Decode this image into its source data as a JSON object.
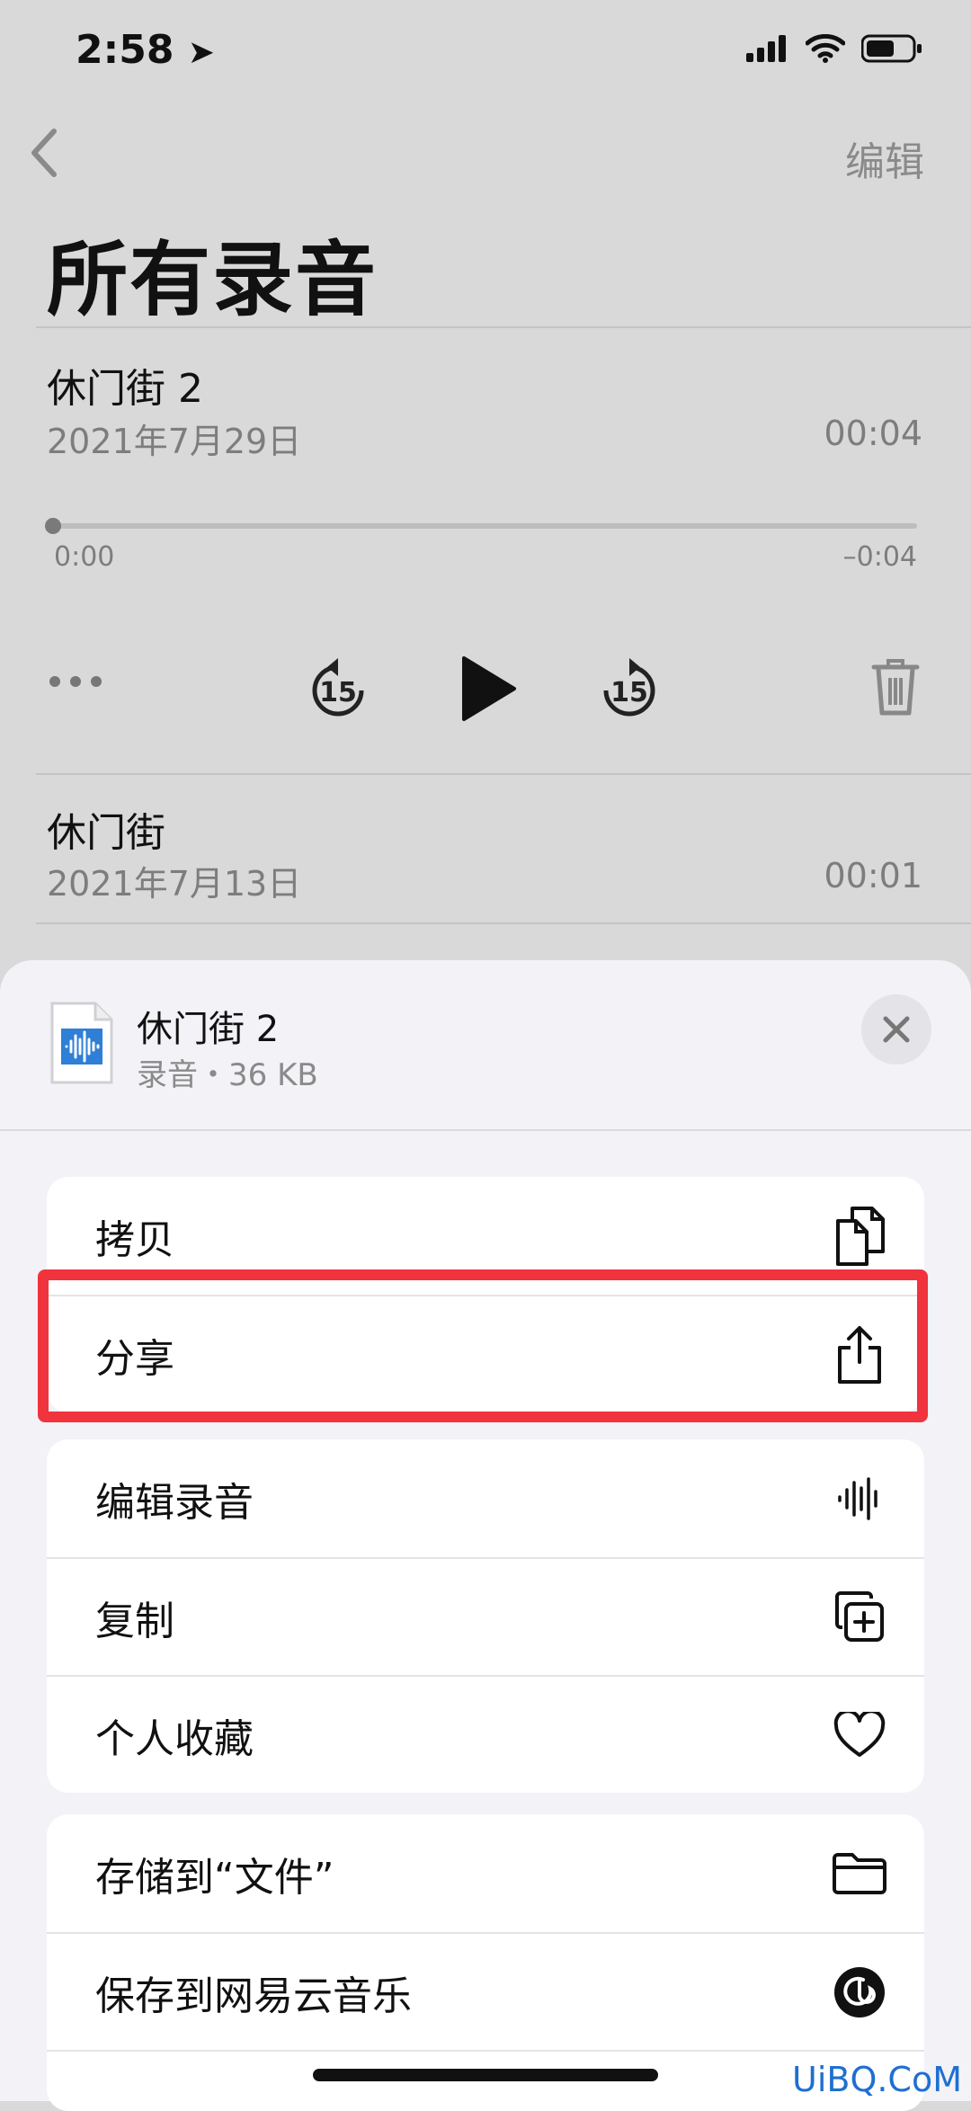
{
  "status_bar": {
    "time": "2:58"
  },
  "header": {
    "edit_label": "编辑",
    "title": "所有录音"
  },
  "recordings": [
    {
      "name": "休门街 2",
      "date": "2021年7月29日",
      "duration": "00:04"
    },
    {
      "name": "休门街",
      "date": "2021年7月13日",
      "duration": "00:01"
    }
  ],
  "player": {
    "elapsed": "0:00",
    "remaining": "–0:04",
    "skip_seconds": "15",
    "progress": 0
  },
  "sheet": {
    "title": "休门街 2",
    "subtitle": "录音・36 KB",
    "groups": [
      [
        {
          "label": "拷贝",
          "icon": "copy-icon"
        },
        {
          "label": "分享",
          "icon": "share-icon"
        }
      ],
      [
        {
          "label": "编辑录音",
          "icon": "waveform-icon"
        },
        {
          "label": "复制",
          "icon": "duplicate-icon"
        },
        {
          "label": "个人收藏",
          "icon": "heart-icon"
        }
      ],
      [
        {
          "label": "存储到“文件”",
          "icon": "folder-icon"
        },
        {
          "label": "保存到网易云音乐",
          "icon": "netease-music-icon"
        }
      ]
    ]
  },
  "highlight_color": "#f0333d",
  "watermark": "UiBQ.CoM"
}
